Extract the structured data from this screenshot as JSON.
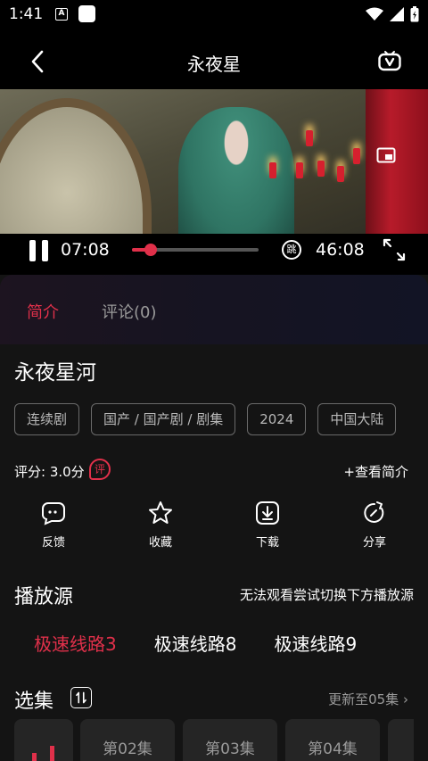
{
  "status": {
    "time": "1:41",
    "a_badge": "A"
  },
  "header": {
    "title": "永夜星"
  },
  "player": {
    "current_time": "07:08",
    "total_time": "46:08",
    "skip_label": "跳",
    "progress": 0.15
  },
  "tabs": [
    {
      "label": "简介"
    },
    {
      "label": "评论(0)"
    }
  ],
  "show": {
    "title": "永夜星河",
    "tags": [
      "连续剧",
      "国产 / 国产剧 / 剧集",
      "2024",
      "中国大陆"
    ],
    "rating": "评分: 3.0分",
    "rating_icon_label": "评",
    "more_intro": "+查看简介"
  },
  "actions": [
    {
      "label": "反馈",
      "icon": "feedback-icon"
    },
    {
      "label": "收藏",
      "icon": "star-icon"
    },
    {
      "label": "下载",
      "icon": "download-icon"
    },
    {
      "label": "分享",
      "icon": "share-icon"
    }
  ],
  "sources": {
    "title": "播放源",
    "hint": "无法观看尝试切换下方播放源",
    "routes": [
      {
        "label": "极速线路3",
        "active": true
      },
      {
        "label": "极速线路8"
      },
      {
        "label": "极速线路9"
      }
    ]
  },
  "episodes": {
    "title": "选集",
    "update": "更新至05集 ›",
    "items": [
      {
        "label": "",
        "playing": true
      },
      {
        "label": "第02集"
      },
      {
        "label": "第03集"
      },
      {
        "label": "第04集"
      },
      {
        "label": "第"
      }
    ]
  },
  "colors": {
    "accent": "#e0304a",
    "background": "#141414",
    "chip_bg": "#252525"
  }
}
